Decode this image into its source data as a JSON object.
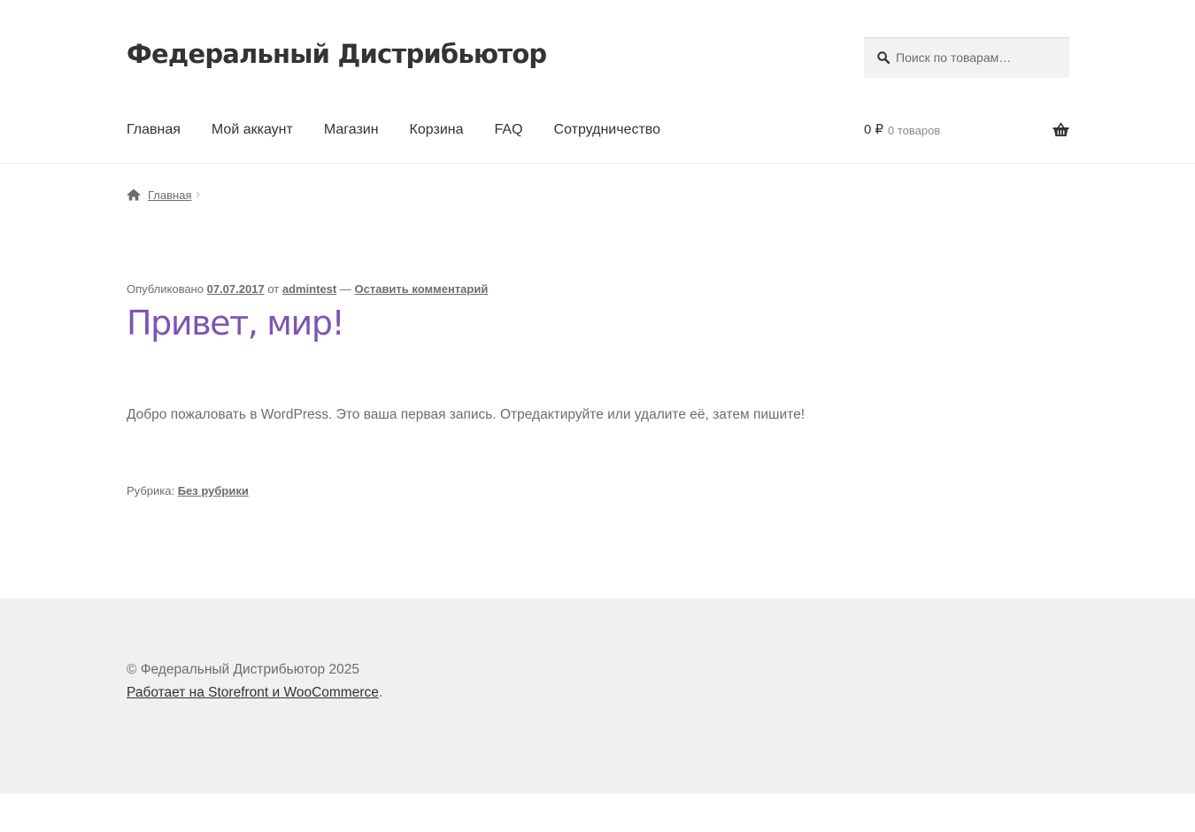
{
  "header": {
    "site_title": "Федеральный Дистрибьютор",
    "search": {
      "placeholder": "Поиск по товарам…",
      "value": ""
    },
    "nav": {
      "items": [
        {
          "label": "Главная"
        },
        {
          "label": "Мой аккаунт"
        },
        {
          "label": "Магазин"
        },
        {
          "label": "Корзина"
        },
        {
          "label": "FAQ"
        },
        {
          "label": "Сотрудничество"
        }
      ]
    },
    "cart": {
      "amount": "0 ₽",
      "count": "0 товаров"
    }
  },
  "breadcrumb": {
    "home_label": "Главная"
  },
  "post": {
    "meta": {
      "published_prefix": "Опубликовано",
      "date": "07.07.2017",
      "by": "от",
      "author": "admintest",
      "dash": "—",
      "comment_link": "Оставить комментарий"
    },
    "title": "Привет, мир!",
    "content": "Добро пожаловать в WordPress. Это ваша первая запись. Отредактируйте или удалите её, затем пишите!",
    "category_prefix": "Рубрика:",
    "category": "Без рубрики"
  },
  "footer": {
    "copyright": "© Федеральный Дистрибьютор 2025",
    "powered_link": "Работает на Storefront и WooCommerce",
    "powered_suffix": "."
  },
  "colors": {
    "accent": "#7f54b3",
    "text": "#6d6d6d",
    "heading": "#333333",
    "footer_bg": "#f0f0f0",
    "search_bg": "#f2f2f2"
  },
  "icons": {
    "search": "search-icon",
    "cart": "basket-icon",
    "home": "home-icon",
    "breadcrumb_separator": "chevron-right-icon"
  }
}
